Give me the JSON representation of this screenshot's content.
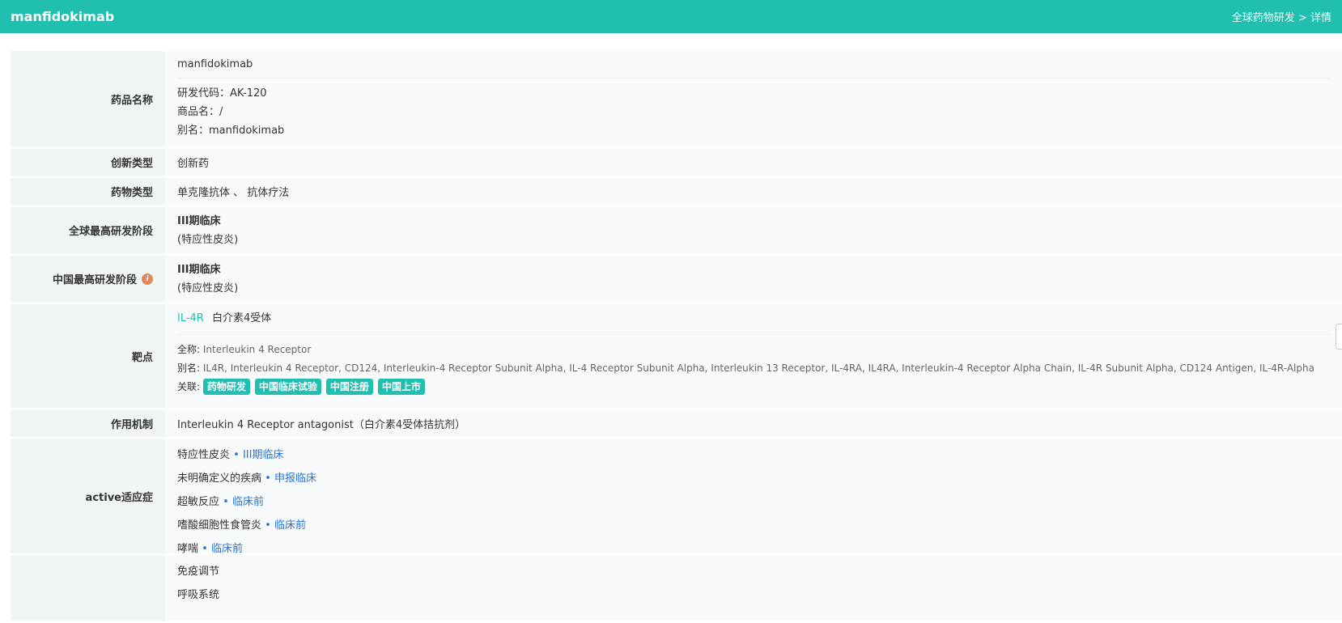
{
  "header": {
    "title": "manfidokimab",
    "crumb_parent": "全球药物研发",
    "crumb_sep": " > ",
    "crumb_current": "详情"
  },
  "drug_name": {
    "label": "药品名称",
    "name": "manfidokimab",
    "code_label": "研发代码：",
    "code": "AK-120",
    "trade_label": "商品名：",
    "trade": "/",
    "alias_label": "别名：",
    "alias": "manfidokimab"
  },
  "innovation": {
    "label": "创新类型",
    "value": "创新药"
  },
  "drug_type": {
    "label": "药物类型",
    "value": "单克隆抗体 、 抗体疗法"
  },
  "global_stage": {
    "label": "全球最高研发阶段",
    "stage": "III期临床",
    "indication": "(特应性皮炎)"
  },
  "china_stage": {
    "label": "中国最高研发阶段",
    "info": "i",
    "stage": "III期临床",
    "indication": "(特应性皮炎)"
  },
  "target": {
    "label": "靶点",
    "symbol": "IL-4R",
    "cn_name": "白介素4受体",
    "fullname_label": "全称:",
    "fullname": "Interleukin 4 Receptor",
    "alias_label": "别名:",
    "aliases": "IL4R, Interleukin 4 Receptor, CD124, Interleukin-4 Receptor Subunit Alpha, IL-4 Receptor Subunit Alpha, Interleukin 13 Receptor, IL-4RA, IL4RA, Interleukin-4 Receptor Alpha Chain, IL-4R Subunit Alpha, CD124 Antigen, IL-4R-Alpha",
    "related_label": "关联:",
    "tags": [
      "药物研发",
      "中国临床试验",
      "中国注册",
      "中国上市"
    ]
  },
  "mechanism": {
    "label": "作用机制",
    "value": "Interleukin 4 Receptor antagonist（白介素4受体拮抗剂）"
  },
  "indications": {
    "label": "active适应症",
    "items": [
      {
        "name": "特应性皮炎",
        "stage": "• III期临床"
      },
      {
        "name": "未明确定义的疾病",
        "stage": "• 申报临床"
      },
      {
        "name": "超敏反应",
        "stage": "• 临床前"
      },
      {
        "name": "嗜酸细胞性食管炎",
        "stage": "• 临床前"
      },
      {
        "name": "哮喘",
        "stage": "• 临床前"
      }
    ]
  },
  "therapeutic_areas": {
    "items": [
      "免疫调节",
      "呼吸系统"
    ]
  }
}
